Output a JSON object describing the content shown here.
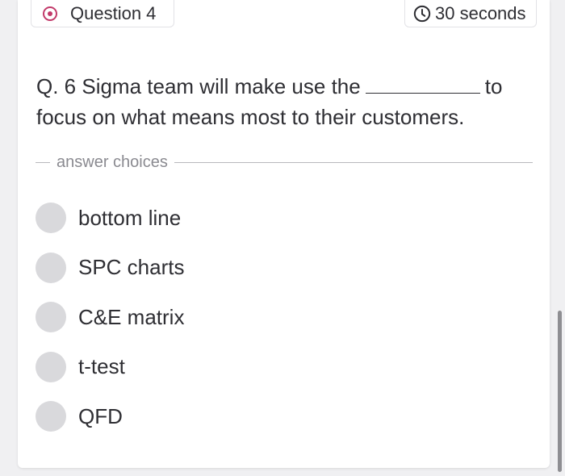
{
  "header": {
    "question_label": "Question 4",
    "timer_label": "30 seconds"
  },
  "question": {
    "prefix": "Q. 6 Sigma team will make use the",
    "suffix": "to focus on what means most to their customers."
  },
  "answers": {
    "section_label": "answer choices",
    "choices": [
      {
        "label": "bottom line"
      },
      {
        "label": "SPC charts"
      },
      {
        "label": "C&E matrix"
      },
      {
        "label": "t-test"
      },
      {
        "label": "QFD"
      }
    ]
  },
  "colors": {
    "accent": "#c23a6a",
    "radio_fill": "#d9d9dc",
    "divider": "#b8b8bc"
  },
  "icons": {
    "question": "radio-target-icon",
    "timer": "clock-icon"
  }
}
